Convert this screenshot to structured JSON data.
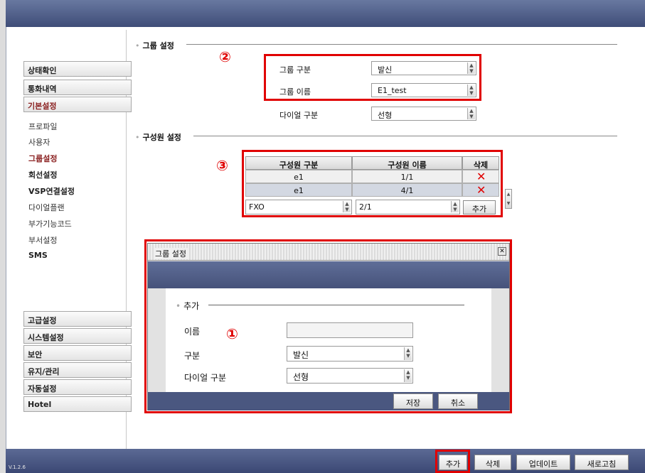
{
  "version": "V.1.2.6",
  "sidebar": {
    "top_items": [
      "상태확인",
      "통화내역",
      "기본설정"
    ],
    "sub_items": [
      "프로파일",
      "사용자",
      "그룹설정",
      "회선설정",
      "VSP연결설정",
      "다이얼플랜",
      "부가기능코드",
      "부서설정",
      "SMS"
    ],
    "bottom_items": [
      "고급설정",
      "시스템설정",
      "보안",
      "유지/관리",
      "자동설정",
      "Hotel"
    ]
  },
  "group_section": {
    "title": "그룹 설정",
    "group_type_label": "그룹 구분",
    "group_type_value": "발신",
    "group_name_label": "그룹 이름",
    "group_name_value": "E1_test",
    "dial_type_label": "다이얼 구분",
    "dial_type_value": "선형"
  },
  "member_section": {
    "title": "구성원 설정",
    "headers": [
      "구성원 구분",
      "구성원 이름",
      "삭제"
    ],
    "rows": [
      {
        "type": "e1",
        "name": "1/1"
      },
      {
        "type": "e1",
        "name": "4/1"
      }
    ],
    "new_row": {
      "type": "FXO",
      "name": "2/1",
      "add_label": "추가"
    }
  },
  "annotations": {
    "one": "①",
    "two": "②",
    "three": "③"
  },
  "dialog": {
    "title": "그룹 설정",
    "section_title": "추가",
    "name_label": "이름",
    "name_value": "",
    "type_label": "구분",
    "type_value": "발신",
    "dial_label": "다이얼 구분",
    "dial_value": "선형",
    "save_label": "저장",
    "cancel_label": "취소"
  },
  "footer_buttons": {
    "add": "추가",
    "delete": "삭제",
    "update": "업데이트",
    "refresh": "새로고침"
  },
  "colors": {
    "highlight": "#e00000",
    "header": "#4b5a85"
  }
}
